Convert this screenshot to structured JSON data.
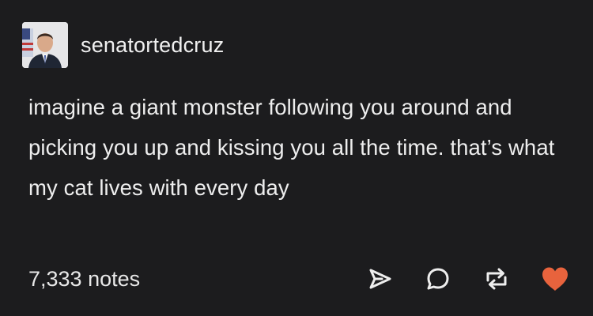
{
  "post": {
    "username": "senatortedcruz",
    "text": "imagine a giant monster following you around and picking you up and kissing you all the time. that’s what my cat lives with every day",
    "notes": "7,333 notes"
  },
  "icons": {
    "share": "share-icon",
    "reply": "reply-icon",
    "reblog": "reblog-icon",
    "like": "heart-icon"
  },
  "colors": {
    "background": "#1c1c1e",
    "text": "#eeeeee",
    "heart": "#e8633d"
  }
}
